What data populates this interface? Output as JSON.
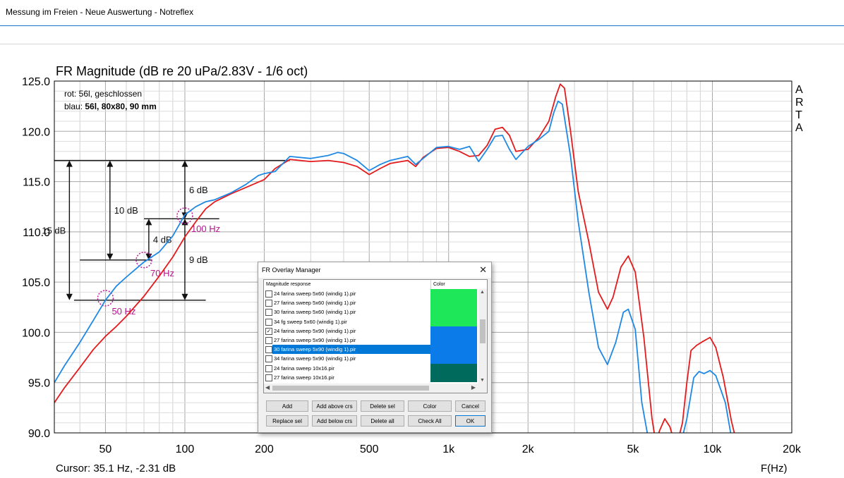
{
  "window": {
    "title": "Messung im Freien - Neue Auswertung - Notreflex"
  },
  "chart_data": {
    "type": "line",
    "title": "FR Magnitude (dB re 20 uPa/2.83V - 1/6 oct)",
    "xlabel": "F(Hz)",
    "xscale": "log",
    "xlim": [
      32,
      20000
    ],
    "ylim": [
      90,
      125
    ],
    "yticks": [
      "125.0",
      "120.0",
      "115.0",
      "110.0",
      "105.0",
      "100.0",
      "95.0",
      "90.0"
    ],
    "xticks": [
      {
        "value": 50,
        "label": "50"
      },
      {
        "value": 100,
        "label": "100"
      },
      {
        "value": 200,
        "label": "200"
      },
      {
        "value": 500,
        "label": "500"
      },
      {
        "value": 1000,
        "label": "1k"
      },
      {
        "value": 2000,
        "label": "2k"
      },
      {
        "value": 5000,
        "label": "5k"
      },
      {
        "value": 10000,
        "label": "10k"
      },
      {
        "value": 20000,
        "label": "20k"
      }
    ],
    "grid": true,
    "brand": [
      "A",
      "R",
      "T",
      "A"
    ],
    "legend_lines": [
      {
        "text": "rot: 56l, geschlossen",
        "bold": false
      },
      {
        "text": "blau: ",
        "bold_part": "56l, 80x80, 90 mm"
      }
    ],
    "cursor_text": "Cursor: 35.1 Hz, -2.31 dB",
    "series": [
      {
        "color": "#e41a1c",
        "points": [
          [
            32,
            93.0
          ],
          [
            35,
            94.5
          ],
          [
            40,
            96.5
          ],
          [
            45,
            98.3
          ],
          [
            50,
            99.6
          ],
          [
            55,
            100.6
          ],
          [
            60,
            101.6
          ],
          [
            70,
            103.6
          ],
          [
            80,
            105.6
          ],
          [
            90,
            107.5
          ],
          [
            100,
            109.5
          ],
          [
            110,
            111.0
          ],
          [
            120,
            112.3
          ],
          [
            130,
            113.0
          ],
          [
            150,
            113.8
          ],
          [
            170,
            114.4
          ],
          [
            200,
            115.2
          ],
          [
            220,
            116.3
          ],
          [
            250,
            117.2
          ],
          [
            300,
            117.0
          ],
          [
            350,
            117.1
          ],
          [
            400,
            116.9
          ],
          [
            450,
            116.5
          ],
          [
            500,
            115.7
          ],
          [
            550,
            116.3
          ],
          [
            600,
            116.8
          ],
          [
            700,
            117.1
          ],
          [
            750,
            116.5
          ],
          [
            800,
            117.4
          ],
          [
            900,
            118.3
          ],
          [
            1000,
            118.4
          ],
          [
            1100,
            118.0
          ],
          [
            1200,
            117.5
          ],
          [
            1300,
            117.6
          ],
          [
            1400,
            118.6
          ],
          [
            1500,
            120.2
          ],
          [
            1600,
            120.4
          ],
          [
            1700,
            119.6
          ],
          [
            1800,
            118.0
          ],
          [
            2000,
            118.2
          ],
          [
            2200,
            119.4
          ],
          [
            2400,
            121.0
          ],
          [
            2550,
            123.5
          ],
          [
            2650,
            124.7
          ],
          [
            2750,
            124.3
          ],
          [
            2900,
            120.0
          ],
          [
            3100,
            114.0
          ],
          [
            3400,
            109.0
          ],
          [
            3700,
            104.0
          ],
          [
            4000,
            102.3
          ],
          [
            4200,
            103.5
          ],
          [
            4500,
            106.5
          ],
          [
            4800,
            107.6
          ],
          [
            5100,
            106.0
          ],
          [
            5500,
            99.5
          ],
          [
            5900,
            91.5
          ],
          [
            6100,
            89.0
          ],
          [
            6300,
            90.2
          ],
          [
            6600,
            91.4
          ],
          [
            6900,
            90.6
          ],
          [
            7100,
            89.5
          ],
          [
            7400,
            89.2
          ],
          [
            7700,
            91.0
          ],
          [
            8000,
            95.0
          ],
          [
            8300,
            98.2
          ],
          [
            8700,
            98.7
          ],
          [
            9200,
            99.1
          ],
          [
            9800,
            99.5
          ],
          [
            10300,
            98.5
          ],
          [
            11000,
            95.5
          ],
          [
            11800,
            91.2
          ],
          [
            12500,
            88.5
          ]
        ]
      },
      {
        "color": "#1e88e5",
        "points": [
          [
            32,
            95.0
          ],
          [
            35,
            96.7
          ],
          [
            40,
            99.0
          ],
          [
            45,
            101.2
          ],
          [
            50,
            103.2
          ],
          [
            55,
            104.6
          ],
          [
            60,
            105.5
          ],
          [
            70,
            107.0
          ],
          [
            80,
            108.0
          ],
          [
            90,
            109.6
          ],
          [
            100,
            111.7
          ],
          [
            110,
            112.5
          ],
          [
            120,
            113.0
          ],
          [
            130,
            113.2
          ],
          [
            150,
            113.9
          ],
          [
            170,
            114.7
          ],
          [
            190,
            115.6
          ],
          [
            200,
            115.8
          ],
          [
            220,
            116.0
          ],
          [
            250,
            117.5
          ],
          [
            300,
            117.3
          ],
          [
            350,
            117.6
          ],
          [
            380,
            117.9
          ],
          [
            400,
            117.8
          ],
          [
            450,
            117.1
          ],
          [
            500,
            116.1
          ],
          [
            550,
            116.7
          ],
          [
            600,
            117.1
          ],
          [
            700,
            117.5
          ],
          [
            750,
            116.7
          ],
          [
            800,
            117.3
          ],
          [
            900,
            118.4
          ],
          [
            1000,
            118.5
          ],
          [
            1100,
            118.2
          ],
          [
            1200,
            118.5
          ],
          [
            1300,
            117.0
          ],
          [
            1400,
            118.2
          ],
          [
            1500,
            119.5
          ],
          [
            1600,
            119.6
          ],
          [
            1700,
            118.2
          ],
          [
            1800,
            117.2
          ],
          [
            2000,
            118.5
          ],
          [
            2200,
            119.2
          ],
          [
            2400,
            120.0
          ],
          [
            2500,
            121.8
          ],
          [
            2600,
            123.0
          ],
          [
            2700,
            122.7
          ],
          [
            2900,
            117.5
          ],
          [
            3100,
            111.0
          ],
          [
            3400,
            104.0
          ],
          [
            3700,
            98.5
          ],
          [
            4000,
            96.8
          ],
          [
            4300,
            99.0
          ],
          [
            4600,
            102.0
          ],
          [
            4800,
            102.3
          ],
          [
            5100,
            100.3
          ],
          [
            5400,
            93.0
          ],
          [
            5800,
            88.5
          ],
          [
            6600,
            89.1
          ],
          [
            7200,
            89.3
          ],
          [
            7700,
            89.6
          ],
          [
            8000,
            91.4
          ],
          [
            8500,
            95.5
          ],
          [
            8900,
            96.1
          ],
          [
            9300,
            95.9
          ],
          [
            9800,
            96.2
          ],
          [
            10300,
            95.7
          ],
          [
            11200,
            93.0
          ],
          [
            12000,
            88.5
          ]
        ]
      }
    ],
    "annotations": {
      "level_lines": [
        {
          "db": 117.1,
          "from_hz": 32,
          "to_hz": 250
        },
        {
          "db": 111.3,
          "from_hz": 70,
          "to_hz": 135
        },
        {
          "db": 107.2,
          "from_hz": 40,
          "to_hz": 75
        },
        {
          "db": 103.2,
          "from_hz": 38,
          "to_hz": 120
        }
      ],
      "arrows": [
        {
          "hz": 36.5,
          "from_db": 117.1,
          "to_db": 103.2,
          "label": "15 dB",
          "label_side": "left"
        },
        {
          "hz": 52,
          "from_db": 117.1,
          "to_db": 107.2,
          "label": "10 dB",
          "label_side": "right"
        },
        {
          "hz": 73,
          "from_db": 111.3,
          "to_db": 107.2,
          "label": "4 dB",
          "label_side": "right"
        },
        {
          "hz": 100,
          "from_db": 117.1,
          "to_db": 111.3,
          "label": "6 dB",
          "label_side": "right"
        },
        {
          "hz": 100,
          "from_db": 111.3,
          "to_db": 103.2,
          "label": "9 dB",
          "label_side": "right"
        }
      ],
      "markers": [
        {
          "hz": 50,
          "db": 103.4,
          "label": "50 Hz"
        },
        {
          "hz": 70,
          "db": 107.2,
          "label": "70 Hz"
        },
        {
          "hz": 100,
          "db": 111.6,
          "label": "100 Hz"
        }
      ]
    }
  },
  "dialog": {
    "title": "FR Overlay Manager",
    "close": "✕",
    "col_response": "Magnitude response",
    "col_color": "Color",
    "rows": [
      {
        "label": "24 farina sweep 5x60 (windig 1).pir",
        "checked": false,
        "color": "#1ee85a",
        "selected": false
      },
      {
        "label": "27 farina sweep 5x60 (windig 1).pir",
        "checked": false,
        "color": "#1ee85a",
        "selected": false
      },
      {
        "label": "30 farina sweep 5x60 (windig 1).pir",
        "checked": false,
        "color": "#1ee85a",
        "selected": false
      },
      {
        "label": "34 fg sweep 5x60 (windig 1).pir",
        "checked": false,
        "color": "#1ee85a",
        "selected": false
      },
      {
        "label": "24 farina sweep 5x90 (windig 1).pir",
        "checked": true,
        "color": "#0a7be8",
        "selected": false
      },
      {
        "label": "27 farina sweep 5x90 (windig 1).pir",
        "checked": false,
        "color": "#0a7be8",
        "selected": false
      },
      {
        "label": "30 farina sweep 5x90 (windig 1).pir",
        "checked": false,
        "color": "#0a7be8",
        "selected": true
      },
      {
        "label": "34 farina sweep 5x90 (windig 1).pir",
        "checked": false,
        "color": "#0a7be8",
        "selected": false
      },
      {
        "label": "24 farina sweep 10x16.pir",
        "checked": false,
        "color": "#006b5c",
        "selected": false
      },
      {
        "label": "27 farina sweep 10x16.pir",
        "checked": false,
        "color": "#006b5c",
        "selected": false
      }
    ],
    "checkmark": "✓",
    "buttons": {
      "add": "Add",
      "add_above": "Add above crs",
      "delete_sel": "Delete sel",
      "color": "Color",
      "cancel": "Cancel",
      "replace_sel": "Replace sel",
      "add_below": "Add below crs",
      "delete_all": "Delete all",
      "check_all": "Check All",
      "ok": "OK"
    }
  }
}
